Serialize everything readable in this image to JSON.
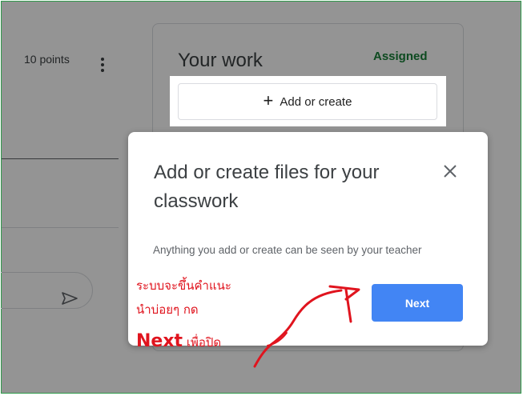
{
  "assignment": {
    "points": "10 points"
  },
  "your_work": {
    "title": "Your work",
    "status": "Assigned",
    "add_label": "Add or create"
  },
  "dialog": {
    "title": "Add or create files for your classwork",
    "body": "Anything you add or create can be seen by your teacher",
    "next_label": "Next"
  },
  "annotation": {
    "line1": "ระบบจะขึ้นคำแนะ",
    "line2": "นำบ่อยๆ กด",
    "line3_bold": "Next",
    "line3_rest": " เพื่อปิด"
  },
  "colors": {
    "primary": "#4285f4",
    "assigned": "#188038",
    "annotation": "#e0141e",
    "border": "#2e9a4a"
  },
  "icons": [
    "more-vert-icon",
    "send-icon",
    "plus-icon",
    "close-icon",
    "hand-drawn-arrow"
  ]
}
